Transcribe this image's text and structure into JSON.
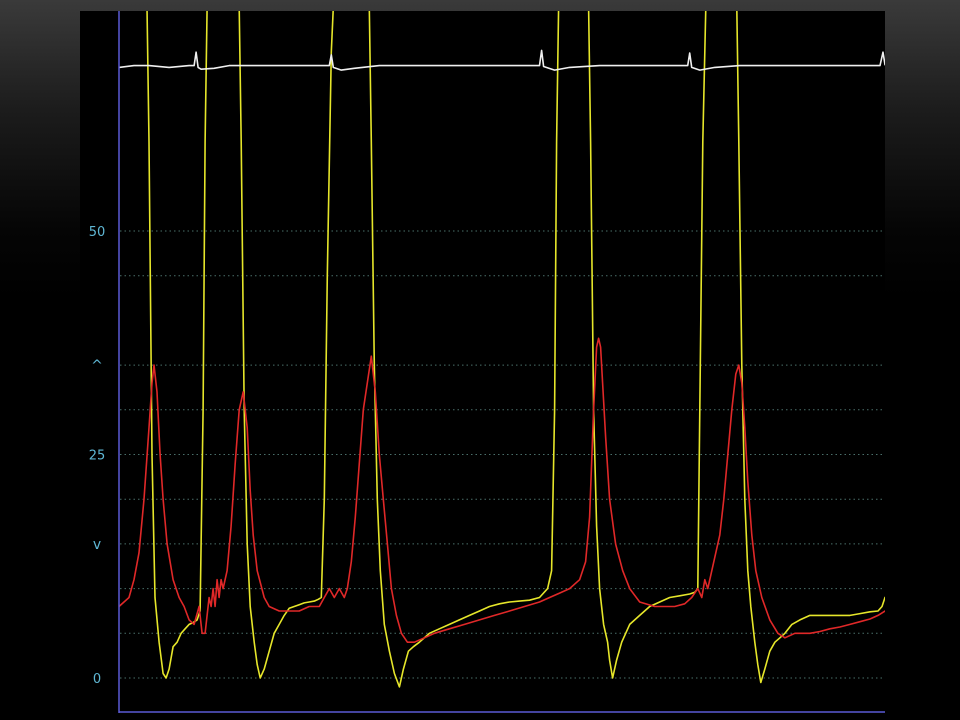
{
  "chart_data": {
    "type": "line",
    "title": "",
    "xlabel": "",
    "ylabel": "",
    "ylim": [
      0,
      75
    ],
    "xlim": [
      0,
      765
    ],
    "grid": true,
    "legend": "none",
    "y_ticks": [
      {
        "value": 50,
        "label": "50"
      },
      {
        "value": 25,
        "label": "25"
      },
      {
        "value": 0,
        "label": "0"
      }
    ],
    "y_markers": [
      {
        "value": 35,
        "label": "^"
      },
      {
        "value": 15,
        "label": "v"
      }
    ],
    "gridlines": [
      50,
      45,
      35,
      30,
      25,
      20,
      15,
      10,
      5,
      0
    ],
    "colors": {
      "axis": "#5b5bd6",
      "grid": "#4a6f6a",
      "tick": "#5fb7d4",
      "background": "#000000"
    },
    "series": [
      {
        "color": "#e6e62a",
        "points": [
          [
            0,
            75
          ],
          [
            28,
            75
          ],
          [
            30,
            60
          ],
          [
            33,
            25
          ],
          [
            36,
            9
          ],
          [
            40,
            4
          ],
          [
            44,
            0.5
          ],
          [
            47,
            0
          ],
          [
            50,
            1
          ],
          [
            54,
            3.5
          ],
          [
            58,
            4
          ],
          [
            62,
            5
          ],
          [
            66,
            5.5
          ],
          [
            70,
            6
          ],
          [
            74,
            6.2
          ],
          [
            78,
            6.5
          ],
          [
            81,
            7.5
          ],
          [
            84,
            30
          ],
          [
            86,
            60
          ],
          [
            88,
            75
          ],
          [
            120,
            75
          ],
          [
            122,
            60
          ],
          [
            125,
            30
          ],
          [
            128,
            15
          ],
          [
            131,
            8
          ],
          [
            135,
            4
          ],
          [
            138,
            1.5
          ],
          [
            141,
            0
          ],
          [
            145,
            1
          ],
          [
            150,
            3
          ],
          [
            155,
            5
          ],
          [
            160,
            6
          ],
          [
            165,
            7
          ],
          [
            170,
            7.8
          ],
          [
            175,
            8
          ],
          [
            180,
            8.2
          ],
          [
            185,
            8.4
          ],
          [
            190,
            8.5
          ],
          [
            195,
            8.6
          ],
          [
            199,
            8.8
          ],
          [
            202,
            9
          ],
          [
            205,
            20
          ],
          [
            208,
            45
          ],
          [
            212,
            70
          ],
          [
            214,
            75
          ],
          [
            250,
            75
          ],
          [
            252,
            60
          ],
          [
            255,
            35
          ],
          [
            258,
            20
          ],
          [
            261,
            12
          ],
          [
            265,
            6
          ],
          [
            270,
            3
          ],
          [
            275,
            0.5
          ],
          [
            280,
            -1
          ],
          [
            284,
            1
          ],
          [
            289,
            3
          ],
          [
            294,
            3.5
          ],
          [
            300,
            4
          ],
          [
            310,
            5
          ],
          [
            320,
            5.5
          ],
          [
            330,
            6
          ],
          [
            340,
            6.5
          ],
          [
            350,
            7
          ],
          [
            360,
            7.5
          ],
          [
            370,
            8
          ],
          [
            380,
            8.3
          ],
          [
            390,
            8.5
          ],
          [
            400,
            8.6
          ],
          [
            410,
            8.7
          ],
          [
            420,
            9
          ],
          [
            428,
            10
          ],
          [
            432,
            12
          ],
          [
            435,
            30
          ],
          [
            437,
            60
          ],
          [
            439,
            75
          ],
          [
            469,
            75
          ],
          [
            471,
            60
          ],
          [
            474,
            30
          ],
          [
            477,
            17
          ],
          [
            480,
            10
          ],
          [
            484,
            6
          ],
          [
            488,
            4
          ],
          [
            490,
            2
          ],
          [
            493,
            0
          ],
          [
            497,
            2
          ],
          [
            502,
            4
          ],
          [
            506,
            5
          ],
          [
            510,
            6
          ],
          [
            515,
            6.5
          ],
          [
            520,
            7
          ],
          [
            530,
            8
          ],
          [
            540,
            8.5
          ],
          [
            550,
            9
          ],
          [
            560,
            9.2
          ],
          [
            570,
            9.4
          ],
          [
            575,
            9.6
          ],
          [
            578,
            10
          ],
          [
            580,
            30
          ],
          [
            583,
            60
          ],
          [
            586,
            75
          ],
          [
            617,
            75
          ],
          [
            619,
            60
          ],
          [
            622,
            35
          ],
          [
            625,
            20
          ],
          [
            628,
            12
          ],
          [
            631,
            8
          ],
          [
            635,
            4
          ],
          [
            638,
            1.5
          ],
          [
            641,
            -0.5
          ],
          [
            645,
            1
          ],
          [
            650,
            3
          ],
          [
            655,
            4
          ],
          [
            660,
            4.5
          ],
          [
            665,
            5
          ],
          [
            672,
            6
          ],
          [
            680,
            6.5
          ],
          [
            690,
            7
          ],
          [
            700,
            7
          ],
          [
            710,
            7
          ],
          [
            720,
            7
          ],
          [
            730,
            7
          ],
          [
            740,
            7.2
          ],
          [
            750,
            7.4
          ],
          [
            758,
            7.5
          ],
          [
            762,
            8
          ],
          [
            765,
            9
          ]
        ]
      },
      {
        "color": "#e02828",
        "points": [
          [
            0,
            8
          ],
          [
            5,
            8.5
          ],
          [
            10,
            9
          ],
          [
            15,
            11
          ],
          [
            20,
            14
          ],
          [
            25,
            20
          ],
          [
            30,
            28
          ],
          [
            33,
            33
          ],
          [
            35,
            35
          ],
          [
            38,
            32
          ],
          [
            41,
            25
          ],
          [
            44,
            20
          ],
          [
            48,
            15
          ],
          [
            54,
            11
          ],
          [
            60,
            9
          ],
          [
            65,
            8
          ],
          [
            70,
            6.5
          ],
          [
            75,
            6
          ],
          [
            80,
            8
          ],
          [
            83,
            5
          ],
          [
            86,
            5
          ],
          [
            88,
            7
          ],
          [
            90,
            9
          ],
          [
            92,
            8
          ],
          [
            94,
            10
          ],
          [
            96,
            8
          ],
          [
            98,
            11
          ],
          [
            100,
            9
          ],
          [
            102,
            11
          ],
          [
            104,
            10
          ],
          [
            108,
            12
          ],
          [
            112,
            17
          ],
          [
            116,
            24
          ],
          [
            120,
            30
          ],
          [
            124,
            32
          ],
          [
            128,
            28
          ],
          [
            131,
            21
          ],
          [
            134,
            16
          ],
          [
            138,
            12
          ],
          [
            145,
            9
          ],
          [
            150,
            8
          ],
          [
            160,
            7.5
          ],
          [
            170,
            7.5
          ],
          [
            180,
            7.5
          ],
          [
            190,
            8
          ],
          [
            200,
            8
          ],
          [
            205,
            9
          ],
          [
            210,
            10
          ],
          [
            215,
            9
          ],
          [
            220,
            10
          ],
          [
            225,
            9
          ],
          [
            228,
            10
          ],
          [
            232,
            13
          ],
          [
            236,
            18
          ],
          [
            240,
            24
          ],
          [
            244,
            30
          ],
          [
            248,
            33
          ],
          [
            252,
            36
          ],
          [
            256,
            32
          ],
          [
            260,
            25
          ],
          [
            264,
            20
          ],
          [
            268,
            15
          ],
          [
            272,
            10
          ],
          [
            277,
            7
          ],
          [
            282,
            5
          ],
          [
            288,
            4
          ],
          [
            295,
            4
          ],
          [
            305,
            4.5
          ],
          [
            315,
            5
          ],
          [
            330,
            5.5
          ],
          [
            345,
            6
          ],
          [
            360,
            6.5
          ],
          [
            375,
            7
          ],
          [
            390,
            7.5
          ],
          [
            405,
            8
          ],
          [
            420,
            8.5
          ],
          [
            430,
            9
          ],
          [
            440,
            9.5
          ],
          [
            450,
            10
          ],
          [
            460,
            11
          ],
          [
            466,
            13
          ],
          [
            470,
            18
          ],
          [
            474,
            30
          ],
          [
            477,
            37
          ],
          [
            479,
            38
          ],
          [
            481,
            37
          ],
          [
            483,
            33
          ],
          [
            486,
            27
          ],
          [
            490,
            20
          ],
          [
            496,
            15
          ],
          [
            503,
            12
          ],
          [
            510,
            10
          ],
          [
            520,
            8.5
          ],
          [
            535,
            8
          ],
          [
            545,
            8
          ],
          [
            555,
            8
          ],
          [
            565,
            8.3
          ],
          [
            572,
            9
          ],
          [
            578,
            10
          ],
          [
            582,
            9
          ],
          [
            585,
            11
          ],
          [
            588,
            10
          ],
          [
            592,
            12
          ],
          [
            596,
            14
          ],
          [
            600,
            16
          ],
          [
            604,
            20
          ],
          [
            608,
            25
          ],
          [
            612,
            30
          ],
          [
            616,
            34
          ],
          [
            619,
            35
          ],
          [
            622,
            33
          ],
          [
            625,
            28
          ],
          [
            628,
            22
          ],
          [
            632,
            16
          ],
          [
            636,
            12
          ],
          [
            642,
            9
          ],
          [
            650,
            6.5
          ],
          [
            658,
            5
          ],
          [
            665,
            4.5
          ],
          [
            675,
            5
          ],
          [
            690,
            5
          ],
          [
            700,
            5.2
          ],
          [
            710,
            5.5
          ],
          [
            720,
            5.7
          ],
          [
            730,
            6
          ],
          [
            740,
            6.3
          ],
          [
            750,
            6.6
          ],
          [
            758,
            7
          ],
          [
            765,
            7.5
          ]
        ]
      },
      {
        "color": "#f0f0f0",
        "points": [
          [
            0,
            68.3
          ],
          [
            15,
            68.5
          ],
          [
            30,
            68.5
          ],
          [
            50,
            68.3
          ],
          [
            70,
            68.5
          ],
          [
            75,
            68.5
          ],
          [
            77,
            70
          ],
          [
            79,
            68.3
          ],
          [
            82,
            68.1
          ],
          [
            95,
            68.2
          ],
          [
            110,
            68.5
          ],
          [
            140,
            68.5
          ],
          [
            170,
            68.5
          ],
          [
            200,
            68.5
          ],
          [
            210,
            68.5
          ],
          [
            212,
            69.7
          ],
          [
            214,
            68.3
          ],
          [
            222,
            68
          ],
          [
            235,
            68.2
          ],
          [
            260,
            68.5
          ],
          [
            300,
            68.5
          ],
          [
            340,
            68.5
          ],
          [
            380,
            68.5
          ],
          [
            420,
            68.5
          ],
          [
            422,
            70.2
          ],
          [
            424,
            68.4
          ],
          [
            435,
            68
          ],
          [
            450,
            68.3
          ],
          [
            480,
            68.5
          ],
          [
            520,
            68.5
          ],
          [
            560,
            68.5
          ],
          [
            568,
            68.5
          ],
          [
            570,
            69.9
          ],
          [
            572,
            68.3
          ],
          [
            580,
            68
          ],
          [
            595,
            68.3
          ],
          [
            620,
            68.5
          ],
          [
            660,
            68.5
          ],
          [
            700,
            68.5
          ],
          [
            740,
            68.5
          ],
          [
            760,
            68.5
          ],
          [
            763,
            70
          ],
          [
            765,
            68.6
          ]
        ]
      }
    ]
  }
}
